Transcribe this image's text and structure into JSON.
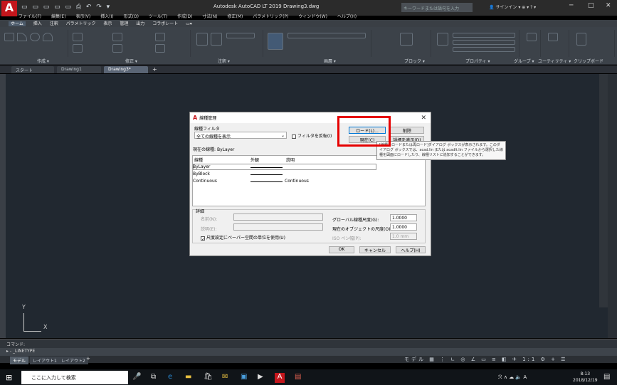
{
  "app": {
    "logo_text": "A",
    "logo_sub": "LT",
    "title": "Autodesk AutoCAD LT 2019    Drawing3.dwg",
    "search_placeholder": "キーワードまたは語句を入力",
    "signin": "サインイン",
    "window_controls": [
      "─",
      "□",
      "✕"
    ]
  },
  "menubar": [
    "ファイル(F)",
    "編集(E)",
    "表示(V)",
    "挿入(I)",
    "形式(O)",
    "ツール(T)",
    "作成(D)",
    "寸法(N)",
    "修正(M)",
    "パラメトリック(P)",
    "ウィンドウ(W)",
    "ヘルプ(H)"
  ],
  "ribbon_tabs": [
    "ホーム",
    "挿入",
    "注釈",
    "パラメトリック",
    "表示",
    "管理",
    "出力",
    "コラボレート"
  ],
  "ribbon_panels": [
    "作成 ▾",
    "修正 ▾",
    "注釈 ▾",
    "画層 ▾",
    "ブロック ▾",
    "プロパティ ▾",
    "グループ ▾",
    "ユーティリティ ▾",
    "クリップボード"
  ],
  "doc_tabs": {
    "start": "スタート",
    "tabs": [
      "Drawing1",
      "Drawing3*"
    ],
    "active_index": 1,
    "add": "+"
  },
  "canvas": {
    "ucs_y": "Y",
    "ucs_x": "X"
  },
  "command": {
    "label": "コマンド:",
    "prompt": "- _LINETYPE"
  },
  "layout_tabs": [
    "モデル",
    "レイアウト1",
    "レイアウト2",
    "+"
  ],
  "statusbar": {
    "model": "モデル",
    "scale": "1:1"
  },
  "taskbar": {
    "search_placeholder": "ここに入力して検索",
    "ime": "A",
    "time": "8:13",
    "date": "2018/12/19"
  },
  "dialog": {
    "title": "線種管理",
    "filter_label": "線種フィルタ",
    "filter_value": "全ての線種を表示",
    "invert_label": "フィルタを反転(I)",
    "current_label": "現在の線種:",
    "current_value": "ByLayer",
    "buttons": {
      "load": "ロード(L)...",
      "delete": "削除",
      "current": "現在(C)",
      "details": "詳細を表示(D)",
      "ok": "OK",
      "cancel": "キャンセル",
      "help": "ヘルプ(H)"
    },
    "columns": [
      "線種",
      "外観",
      "説明"
    ],
    "rows": [
      {
        "name": "ByLayer",
        "appearance": "line",
        "description": ""
      },
      {
        "name": "ByBlock",
        "appearance": "line",
        "description": ""
      },
      {
        "name": "Continuous",
        "appearance": "line",
        "description": "Continuous"
      }
    ],
    "details": {
      "group_label": "詳細",
      "name_label": "名前(N):",
      "desc_label": "説明(E):",
      "paper_space_label": "尺度設定にペーパー空間の単位を使用(U)",
      "global_scale_label": "グローバル線種尺度(G):",
      "global_scale_value": "1.0000",
      "object_scale_label": "現在のオブジェクトの尺度(O):",
      "object_scale_value": "1.0000",
      "pen_label": "ISO ペン幅(P):",
      "pen_value": "1.0 mm"
    }
  },
  "tooltip": {
    "text": "[線種をロードまたは再ロード]ダイアログ ボックスが表示されます。このダイアログ ボックスでは、acad.lin または acadlt.lin ファイルから選択した線種を図面にロードしたり、線種リストに追加することができます。"
  },
  "colors": {
    "highlight": "#e60000",
    "canvas": "#212830",
    "ribbon": "#3c4249",
    "brand": "#c4161c"
  }
}
